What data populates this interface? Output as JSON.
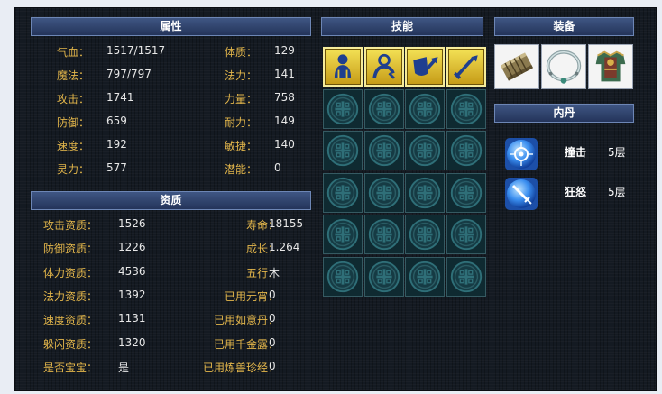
{
  "sections": {
    "attributes": "属性",
    "skills": "技能",
    "equipment": "装备",
    "neidan": "内丹",
    "aptitude": "资质"
  },
  "attributes": [
    {
      "l1": "气血：",
      "v1": "1517/1517",
      "l2": "体质：",
      "v2": "129"
    },
    {
      "l1": "魔法：",
      "v1": "797/797",
      "l2": "法力：",
      "v2": "141"
    },
    {
      "l1": "攻击：",
      "v1": "1741",
      "l2": "力量：",
      "v2": "758"
    },
    {
      "l1": "防御：",
      "v1": "659",
      "l2": "耐力：",
      "v2": "149"
    },
    {
      "l1": "速度：",
      "v1": "192",
      "l2": "敏捷：",
      "v2": "140"
    },
    {
      "l1": "灵力：",
      "v1": "577",
      "l2": "潜能：",
      "v2": "0"
    }
  ],
  "aptitude": [
    {
      "l1": "攻击资质：",
      "v1": "1526",
      "l2": "寿命：",
      "v2": "18155"
    },
    {
      "l1": "防御资质：",
      "v1": "1226",
      "l2": "成长：",
      "v2": "1.264"
    },
    {
      "l1": "体力资质：",
      "v1": "4536",
      "l2": "五行：",
      "v2": "木"
    },
    {
      "l1": "法力资质：",
      "v1": "1392",
      "l2": "已用元宵：",
      "v2": "0"
    },
    {
      "l1": "速度资质：",
      "v1": "1131",
      "l2": "已用如意丹：",
      "v2": "0"
    },
    {
      "l1": "躲闪资质：",
      "v1": "1320",
      "l2": "已用千金露：",
      "v2": "0"
    },
    {
      "l1": "是否宝宝：",
      "v1": "是",
      "l2": "已用炼兽珍经：",
      "v2": "0"
    }
  ],
  "skills": {
    "learned_icons": [
      "person-silhouette-icon",
      "person-halo-icon",
      "shield-sword-icon",
      "sword-icon"
    ],
    "grid_rows": 6,
    "grid_cols": 4,
    "empty_slot_icon": "jade-knot-icon"
  },
  "equipment": {
    "items": [
      "bracelet-icon",
      "necklace-ring-icon",
      "armor-icon"
    ]
  },
  "neidan": {
    "items": [
      {
        "name": "撞击",
        "level": "5层",
        "icon": "blue-orb-target-icon"
      },
      {
        "name": "狂怒",
        "level": "5层",
        "icon": "blue-orb-sword-icon"
      }
    ]
  },
  "colors": {
    "label": "#e3b64b",
    "value": "#e7e7e7",
    "header_bg": "#2d4270",
    "panel_bg": "#141a22",
    "skill_gold": "#e8c530",
    "slot_teal": "#2f6f78"
  }
}
